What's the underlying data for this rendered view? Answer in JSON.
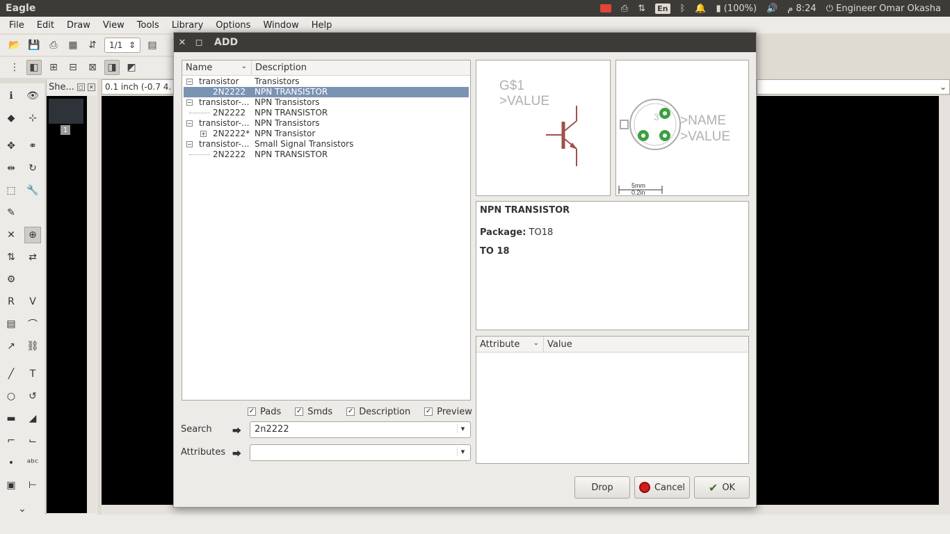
{
  "top_panel": {
    "app_title": "Eagle",
    "battery": "(100%)",
    "keyboard": "En",
    "time": "8:24",
    "ampm": "م",
    "user": "Engineer Omar Okasha"
  },
  "menubar": [
    "File",
    "Edit",
    "Draw",
    "View",
    "Tools",
    "Library",
    "Options",
    "Window",
    "Help"
  ],
  "toolbar": {
    "sheet_value": "1/1"
  },
  "sheets_panel": {
    "title": "She...",
    "sheet_number": "1"
  },
  "coordinates": "0.1 inch (-0.7 4.",
  "dialog": {
    "title": "ADD",
    "tree_headers": {
      "name": "Name",
      "description": "Description"
    },
    "tree_rows": [
      {
        "name": "transistor",
        "desc": "Transistors"
      },
      {
        "name": "2N2222",
        "desc": "NPN TRANSISTOR"
      },
      {
        "name": "transistor-...",
        "desc": "NPN Transistors"
      },
      {
        "name": "2N2222",
        "desc": "NPN TRANSISTOR"
      },
      {
        "name": "transistor-...",
        "desc": "NPN Transistors"
      },
      {
        "name": "2N2222*",
        "desc": "NPN Transistor"
      },
      {
        "name": "transistor-...",
        "desc": "Small Signal Transistors"
      },
      {
        "name": "2N2222",
        "desc": "NPN TRANSISTOR"
      }
    ],
    "checkboxes": {
      "pads": "Pads",
      "smds": "Smds",
      "description": "Description",
      "preview": "Preview"
    },
    "search": {
      "label": "Search",
      "value": "2n2222"
    },
    "attributes": {
      "label": "Attributes",
      "value": ""
    },
    "symbol_preview": {
      "name": "G$1",
      "value": ">VALUE"
    },
    "package_preview": {
      "name": ">NAME",
      "value": ">VALUE",
      "scale_mm": "5mm",
      "scale_in": "0.2in",
      "pad_label": "3"
    },
    "description": {
      "title": "NPN TRANSISTOR",
      "package_label": "Package:",
      "package_value": "TO18",
      "extra": "TO 18"
    },
    "attr_headers": {
      "attribute": "Attribute",
      "value": "Value"
    },
    "buttons": {
      "drop": "Drop",
      "cancel": "Cancel",
      "ok": "OK"
    }
  },
  "colors": {
    "selection": "#7b93b3",
    "symbol": "#a0504a",
    "pad": "#3aa040",
    "panel_dark": "#3c3b37"
  }
}
